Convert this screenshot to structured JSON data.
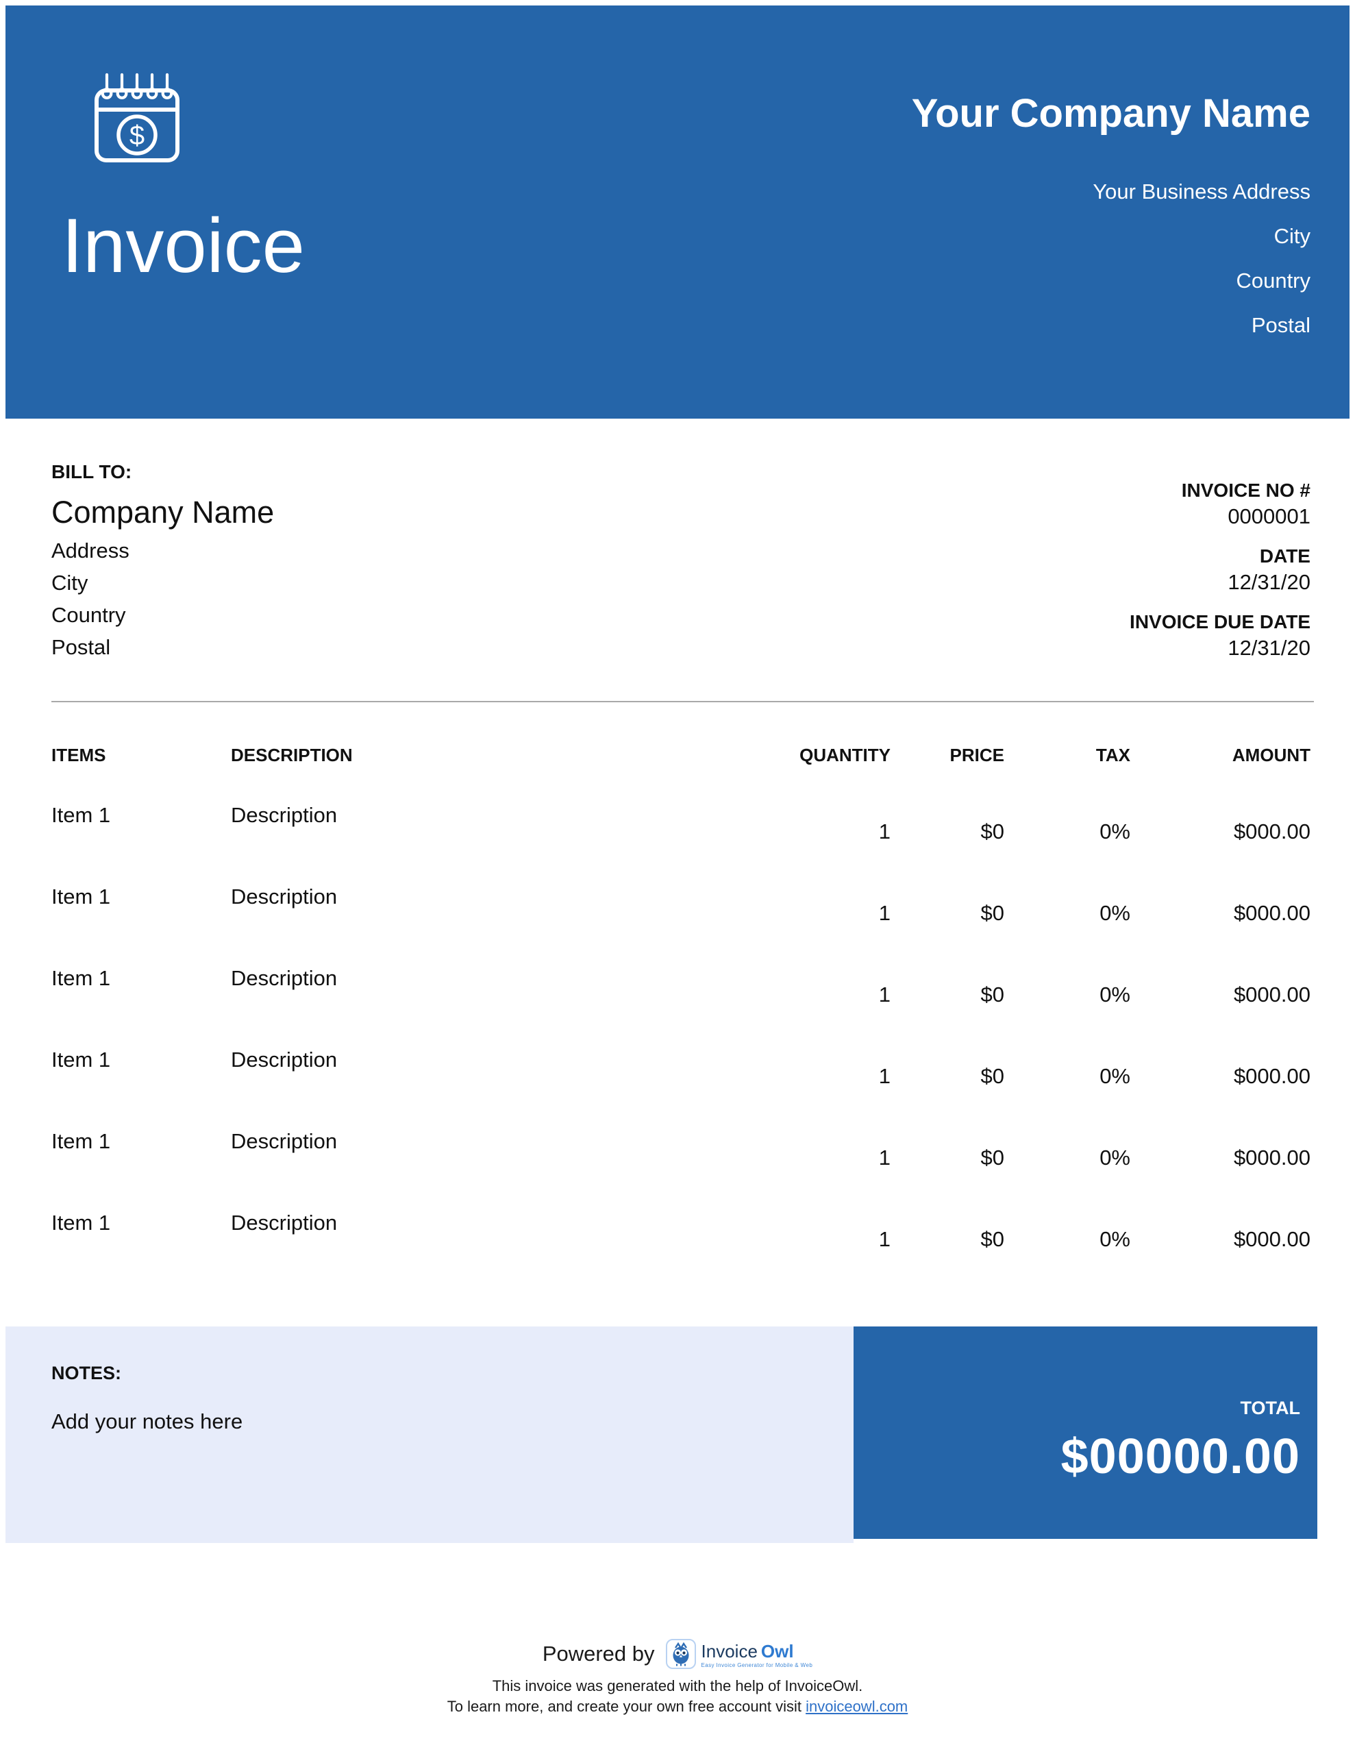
{
  "colors": {
    "accent_blue": "#2565A9",
    "notes_bg": "#E7ECFA",
    "link_blue": "#2E71C8",
    "logo_navy": "#1C3B60",
    "logo_blue": "#2E7AD0"
  },
  "header": {
    "invoice_title": "Invoice",
    "company_name": "Your Company Name",
    "address_lines": [
      "Your Business Address",
      "City",
      "Country",
      "Postal"
    ],
    "icon": "calendar-dollar-icon",
    "icon_glyph": "$"
  },
  "bill_to": {
    "label": "BILL TO:",
    "company": "Company Name",
    "lines": [
      "Address",
      "City",
      "Country",
      "Postal"
    ]
  },
  "invoice_meta": [
    {
      "label": "INVOICE NO #",
      "value": "0000001"
    },
    {
      "label": "DATE",
      "value": "12/31/20"
    },
    {
      "label": "INVOICE DUE DATE",
      "value": "12/31/20"
    }
  ],
  "items_table": {
    "columns": [
      "ITEMS",
      "DESCRIPTION",
      "QUANTITY",
      "PRICE",
      "TAX",
      "AMOUNT"
    ],
    "rows": [
      {
        "item": "Item 1",
        "description": "Description",
        "quantity": "1",
        "price": "$0",
        "tax": "0%",
        "amount": "$000.00"
      },
      {
        "item": "Item 1",
        "description": "Description",
        "quantity": "1",
        "price": "$0",
        "tax": "0%",
        "amount": "$000.00"
      },
      {
        "item": "Item 1",
        "description": "Description",
        "quantity": "1",
        "price": "$0",
        "tax": "0%",
        "amount": "$000.00"
      },
      {
        "item": "Item 1",
        "description": "Description",
        "quantity": "1",
        "price": "$0",
        "tax": "0%",
        "amount": "$000.00"
      },
      {
        "item": "Item 1",
        "description": "Description",
        "quantity": "1",
        "price": "$0",
        "tax": "0%",
        "amount": "$000.00"
      },
      {
        "item": "Item 1",
        "description": "Description",
        "quantity": "1",
        "price": "$0",
        "tax": "0%",
        "amount": "$000.00"
      }
    ]
  },
  "notes": {
    "label": "NOTES:",
    "text": "Add your notes here"
  },
  "total": {
    "label": "TOTAL",
    "amount": "$00000.00"
  },
  "footer": {
    "powered_by": "Powered by",
    "logo": {
      "owl_icon": "owl-icon",
      "brand_first": "Invoice",
      "brand_second": "Owl",
      "tagline": "Easy Invoice Generator for Mobile & Web"
    },
    "line1": "This invoice was generated with the help of InvoiceOwl.",
    "line2_prefix": "To learn more, and create your own free account visit ",
    "link_text": "invoiceowl.com"
  }
}
